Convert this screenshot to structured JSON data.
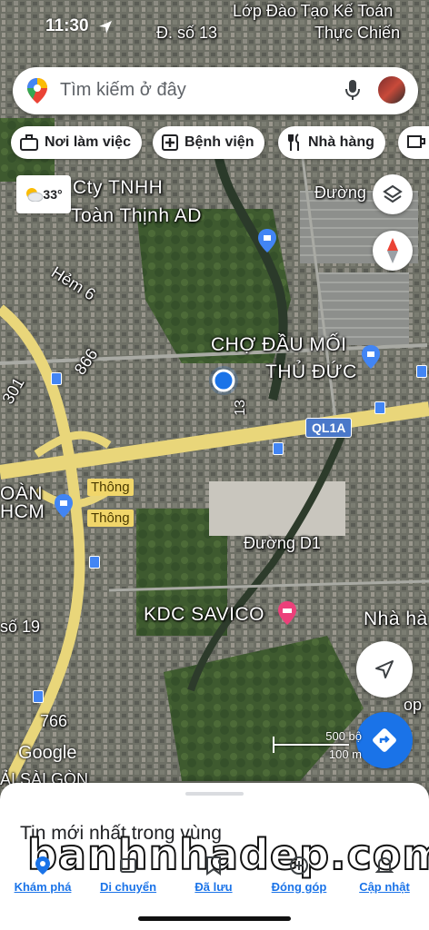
{
  "status_bar": {
    "time": "11:30"
  },
  "search": {
    "placeholder": "Tìm kiếm ở đây"
  },
  "chips": [
    {
      "label": "Nơi làm việc",
      "icon": "briefcase-icon"
    },
    {
      "label": "Bệnh viện",
      "icon": "hospital-icon"
    },
    {
      "label": "Nhà hàng",
      "icon": "restaurant-icon"
    }
  ],
  "weather": {
    "temp": "33°",
    "icon": "partly-cloudy-icon"
  },
  "map_labels": {
    "top_street": "Đ. số 13",
    "lop_dao_tao": "Lớp Đào Tạo Kế Toán",
    "thuc_chien": "Thực Chiến",
    "cty_line1": "Cty TNHH",
    "cty_line2": "Toàn Thịnh AD",
    "duong_top": "Đường",
    "hem6": "Hẻm 6",
    "road_866": "866",
    "road_301": "301",
    "cho_line1": "CHỢ ĐẦU MỐI",
    "cho_line2": "THỦ ĐỨC",
    "ql1a": "QL1A",
    "road_13": "13",
    "toan": "OÀN",
    "hcm": "HCM",
    "thong1": "Thông",
    "thong2": "Thông",
    "duong_d1": "Đường D1",
    "kdc_savico": "KDC SAVICO",
    "nha_ha": "Nhà hà",
    "so19": "số 19",
    "road_766": "766",
    "op": "op",
    "sai_gon": "ẢI SÀI GÒN",
    "google": "Google"
  },
  "scale": {
    "imperial": "500 bộ",
    "metric": "100 m"
  },
  "sheet": {
    "title": "Tin mới nhất trong vùng",
    "watermark": "banhnhadep.com"
  },
  "bottom_nav": [
    {
      "label": "Khám phá",
      "active": true
    },
    {
      "label": "Di chuyển",
      "active": false
    },
    {
      "label": "Đã lưu",
      "active": false
    },
    {
      "label": "Đóng góp",
      "active": false
    },
    {
      "label": "Cập nhật",
      "active": false
    }
  ],
  "colors": {
    "accent": "#1a73e8",
    "road_major": "#f1d66a",
    "satellite": "#3d4a38"
  }
}
